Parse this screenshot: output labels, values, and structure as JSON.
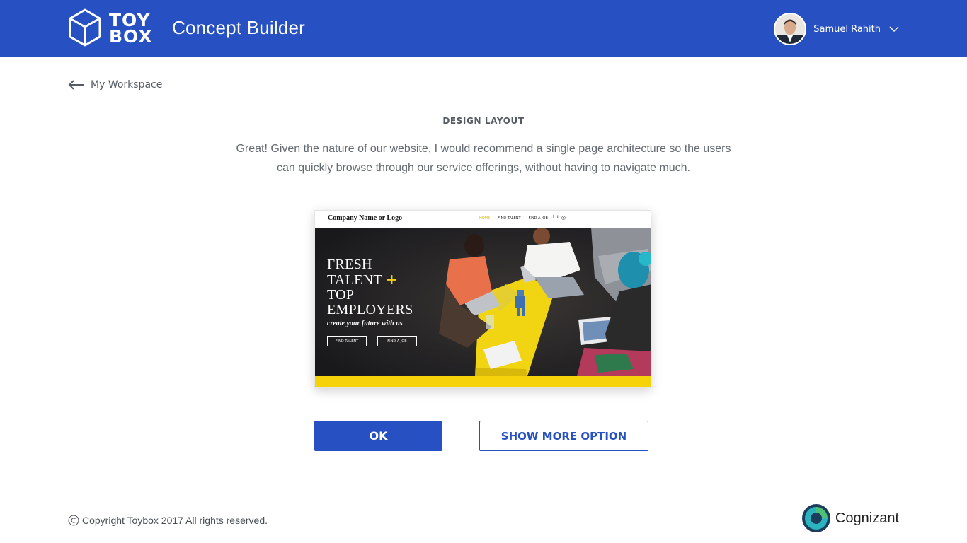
{
  "header": {
    "logo_line1": "TOY",
    "logo_line2": "BOX",
    "app_title": "Concept Builder",
    "user_name": "Samuel Rahith"
  },
  "nav": {
    "back_label": "My Workspace"
  },
  "main": {
    "section_title": "DESIGN LAYOUT",
    "description": "Great! Given the nature of our website, I would recommend a single page architecture so the users can quickly browse through our service offerings, without having to navigate much."
  },
  "preview": {
    "brand": "Company Name or Logo",
    "menu": [
      "HOME",
      "FIND TALENT",
      "FIND A JOB"
    ],
    "social": [
      "f",
      "t",
      "◎"
    ],
    "headline_1": "FRESH",
    "headline_2": "TALENT",
    "headline_plus": "+",
    "headline_3": "TOP",
    "headline_4": "EMPLOYERS",
    "tagline": "create your future with us",
    "btn_find_talent": "FIND TALENT",
    "btn_find_job": "FIND A JOB"
  },
  "actions": {
    "ok_label": "OK",
    "more_label": "SHOW MORE OPTION"
  },
  "footer": {
    "copyright": "Copyright Toybox 2017 All rights reserved.",
    "partner": "Cognizant"
  },
  "colors": {
    "brand_blue": "#2751c2",
    "accent_yellow": "#f5d20a"
  }
}
